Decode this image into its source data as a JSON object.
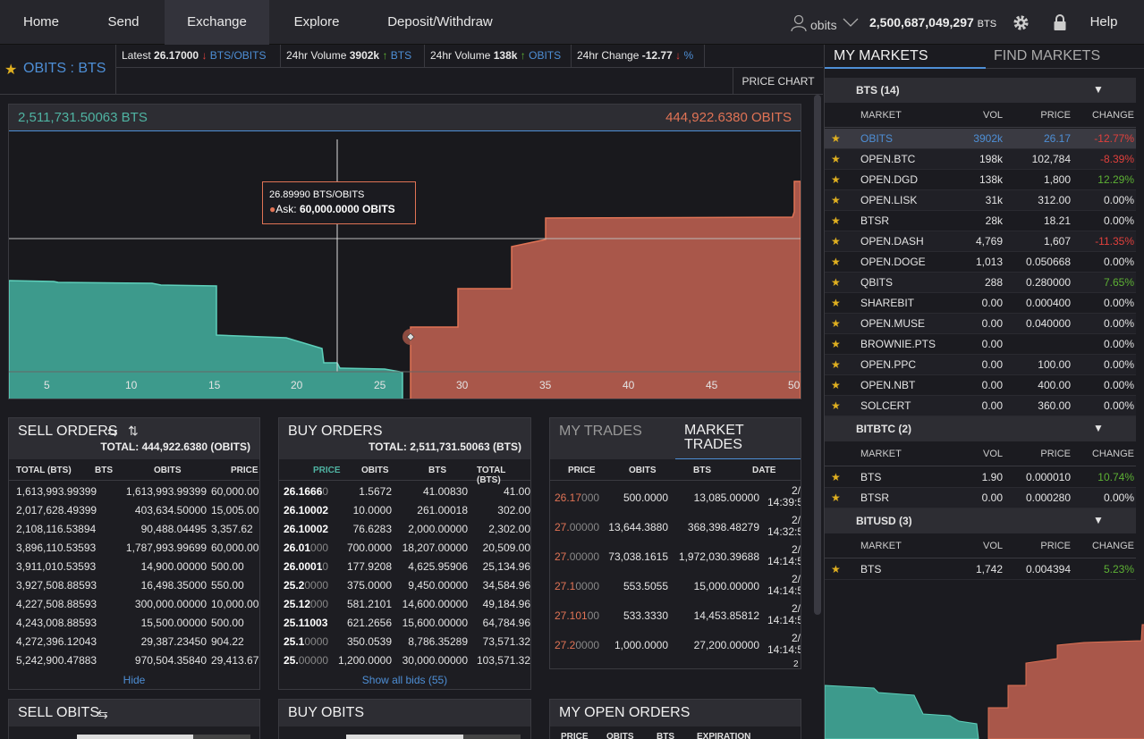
{
  "nav": {
    "home": "Home",
    "send": "Send",
    "exchange": "Exchange",
    "explore": "Explore",
    "deposit": "Deposit/Withdraw",
    "account": "obits",
    "balance": "2,500,687,049,297",
    "balance_unit": "BTS",
    "help": "Help"
  },
  "ticker": {
    "market": "OBITS : BTS",
    "latest_label": "Latest",
    "latest_value": "26.17000",
    "latest_unit": "BTS/OBITS",
    "vol1_label": "24hr Volume",
    "vol1_value": "3902k",
    "vol1_unit": "BTS",
    "vol2_label": "24hr Volume",
    "vol2_value": "138k",
    "vol2_unit": "OBITS",
    "change_label": "24hr Change",
    "change_value": "-12.77",
    "change_unit": "%",
    "price_chart": "PRICE CHART"
  },
  "depth": {
    "bid_total": "2,511,731.50063 BTS",
    "ask_total": "444,922.6380 OBITS",
    "tooltip_price": "26.89990 BTS/OBITS",
    "tooltip_label": "Ask:",
    "tooltip_value": "60,000.0000 OBITS",
    "x_ticks": [
      "5",
      "10",
      "15",
      "20",
      "25",
      "30",
      "35",
      "40",
      "45",
      "50"
    ],
    "bid_color": "#3d9a8c",
    "ask_color": "#a9574a"
  },
  "sell_orders": {
    "title": "SELL ORDERS",
    "total": "TOTAL: 444,922.6380 (OBITS)",
    "cols": [
      "TOTAL (BTS)",
      "BTS",
      "OBITS",
      "PRICE"
    ],
    "rows": [
      [
        "1,613,993.99399",
        "1,613,993.99399",
        "60,000.00"
      ],
      [
        "2,017,628.49399",
        "403,634.50000",
        "15,005.00"
      ],
      [
        "2,108,116.53894",
        "90,488.04495",
        "3,357.62"
      ],
      [
        "3,896,110.53593",
        "1,787,993.99699",
        "60,000.00"
      ],
      [
        "3,911,010.53593",
        "14,900.00000",
        "500.00"
      ],
      [
        "3,927,508.88593",
        "16,498.35000",
        "550.00"
      ],
      [
        "4,227,508.88593",
        "300,000.00000",
        "10,000.00"
      ],
      [
        "4,243,008.88593",
        "15,500.00000",
        "500.00"
      ],
      [
        "4,272,396.12043",
        "29,387.23450",
        "904.22"
      ],
      [
        "5,242,900.47883",
        "970,504.35840",
        "29,413.67"
      ]
    ],
    "hide": "Hide"
  },
  "buy_orders": {
    "title": "BUY ORDERS",
    "total": "TOTAL: 2,511,731.50063 (BTS)",
    "cols": [
      "PRICE",
      "OBITS",
      "BTS",
      "TOTAL (BTS)"
    ],
    "rows": [
      [
        "26.1666",
        "0",
        "1.5672",
        "41.00830",
        "41.00"
      ],
      [
        "26.10002",
        "",
        "10.0000",
        "261.00018",
        "302.00"
      ],
      [
        "26.10002",
        "",
        "76.6283",
        "2,000.00000",
        "2,302.00"
      ],
      [
        "26.01",
        "000",
        "700.0000",
        "18,207.00000",
        "20,509.00"
      ],
      [
        "26.0001",
        "0",
        "177.9208",
        "4,625.95906",
        "25,134.96"
      ],
      [
        "25.2",
        "0000",
        "375.0000",
        "9,450.00000",
        "34,584.96"
      ],
      [
        "25.12",
        "000",
        "581.2101",
        "14,600.00000",
        "49,184.96"
      ],
      [
        "25.11003",
        "",
        "621.2656",
        "15,600.00000",
        "64,784.96"
      ],
      [
        "25.1",
        "0000",
        "350.0539",
        "8,786.35289",
        "73,571.32"
      ],
      [
        "25.",
        "00000",
        "1,200.0000",
        "30,000.00000",
        "103,571.32"
      ]
    ],
    "show_all": "Show all bids (55)"
  },
  "trades": {
    "tab_my": "MY TRADES",
    "tab_market_1": "MARKET",
    "tab_market_2": "TRADES",
    "cols": [
      "PRICE",
      "OBITS",
      "BTS",
      "DATE"
    ],
    "rows": [
      [
        "26.17",
        "000",
        "500.0000",
        "13,085.00000",
        "2/",
        "14:39:5"
      ],
      [
        "27.",
        "00000",
        "13,644.3880",
        "368,398.48279",
        "2/",
        "14:32:5"
      ],
      [
        "27.",
        "00000",
        "73,038.1615",
        "1,972,030.39688",
        "2/",
        "14:14:5"
      ],
      [
        "27.1",
        "0000",
        "553.5055",
        "15,000.00000",
        "2/",
        "14:14:5"
      ],
      [
        "27.101",
        "00",
        "533.3330",
        "14,453.85812",
        "2/",
        "14:14:5"
      ],
      [
        "27.2",
        "0000",
        "1,000.0000",
        "27,200.00000",
        "2/",
        "14:14:5"
      ]
    ],
    "last_partial": "2"
  },
  "sell_obits": {
    "title": "SELL OBITS"
  },
  "buy_obits": {
    "title": "BUY OBITS"
  },
  "open_orders": {
    "title": "MY OPEN ORDERS",
    "cols": [
      "PRICE",
      "OBITS",
      "BTS",
      "EXPIRATION"
    ]
  },
  "sidebar": {
    "tab_my": "MY MARKETS",
    "tab_find": "FIND MARKETS",
    "cols": [
      "MARKET",
      "VOL",
      "PRICE",
      "CHANGE"
    ],
    "groups": [
      {
        "name": "BTS (14)",
        "rows": [
          {
            "prefix": "",
            "name": "OBITS",
            "vol": "3902k",
            "price": "26.17",
            "change": "-12.77%",
            "ctype": "neg"
          },
          {
            "prefix": "OPEN.",
            "name": "BTC",
            "vol": "198k",
            "price": "102,784",
            "change": "-8.39%",
            "ctype": "neg"
          },
          {
            "prefix": "OPEN.",
            "name": "DGD",
            "vol": "138k",
            "price": "1,800",
            "change": "12.29%",
            "ctype": "pos"
          },
          {
            "prefix": "OPEN.",
            "name": "LISK",
            "vol": "31k",
            "price": "312.00",
            "change": "0.00%",
            "ctype": "zero"
          },
          {
            "prefix": "",
            "name": "BTSR",
            "vol": "28k",
            "price": "18.21",
            "change": "0.00%",
            "ctype": "zero"
          },
          {
            "prefix": "OPEN.",
            "name": "DASH",
            "vol": "4,769",
            "price": "1,607",
            "change": "-11.35%",
            "ctype": "neg"
          },
          {
            "prefix": "OPEN.",
            "name": "DOGE",
            "vol": "1,013",
            "price": "0.050668",
            "change": "0.00%",
            "ctype": "zero"
          },
          {
            "prefix": "",
            "name": "QBITS",
            "vol": "288",
            "price": "0.280000",
            "change": "7.65%",
            "ctype": "pos"
          },
          {
            "prefix": "",
            "name": "SHAREBIT",
            "vol": "0.00",
            "price": "0.000400",
            "change": "0.00%",
            "ctype": "zero"
          },
          {
            "prefix": "OPEN.",
            "name": "MUSE",
            "vol": "0.00",
            "price": "0.040000",
            "change": "0.00%",
            "ctype": "zero"
          },
          {
            "prefix": "",
            "name": "BROWNIE.PTS",
            "vol": "0.00",
            "price": "",
            "change": "0.00%",
            "ctype": "zero"
          },
          {
            "prefix": "OPEN.",
            "name": "PPC",
            "vol": "0.00",
            "price": "100.00",
            "change": "0.00%",
            "ctype": "zero"
          },
          {
            "prefix": "OPEN.",
            "name": "NBT",
            "vol": "0.00",
            "price": "400.00",
            "change": "0.00%",
            "ctype": "zero"
          },
          {
            "prefix": "",
            "name": "SOLCERT",
            "vol": "0.00",
            "price": "360.00",
            "change": "0.00%",
            "ctype": "zero"
          }
        ]
      },
      {
        "name": "BITBTC (2)",
        "rows": [
          {
            "prefix": "",
            "name": "BTS",
            "vol": "1.90",
            "price": "0.000010",
            "change": "10.74%",
            "ctype": "pos"
          },
          {
            "prefix": "",
            "name": "BTSR",
            "vol": "0.00",
            "price": "0.000280",
            "change": "0.00%",
            "ctype": "zero"
          }
        ]
      },
      {
        "name": "BITUSD (3)",
        "rows": [
          {
            "prefix": "",
            "name": "BTS",
            "vol": "1,742",
            "price": "0.004394",
            "change": "5.23%",
            "ctype": "pos"
          }
        ]
      }
    ]
  }
}
